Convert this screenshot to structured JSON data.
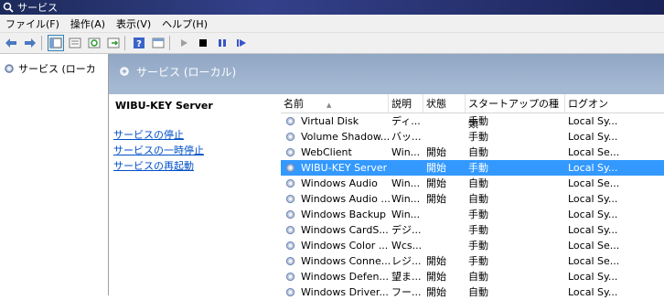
{
  "window": {
    "title": "サービス"
  },
  "menu": [
    "ファイル(F)",
    "操作(A)",
    "表示(V)",
    "ヘルプ(H)"
  ],
  "toolbar": {
    "icons": [
      "back-arrow-icon",
      "forward-arrow-icon",
      "console-tree-icon",
      "properties-icon",
      "refresh-icon",
      "export-list-icon",
      "help-icon",
      "standard-view-icon",
      "start-service-icon",
      "stop-service-icon",
      "pause-service-icon",
      "restart-service-icon"
    ],
    "colors": {
      "play": "#a0a0a0",
      "stop": "#000000",
      "pause": "#3a55c8",
      "restart": "#3a55c8"
    }
  },
  "tree": {
    "root_label": "サービス (ローカ"
  },
  "panel_header": {
    "title": "サービス (ローカル)"
  },
  "description": {
    "service_name": "WIBU-KEY Server",
    "links": [
      "サービスの停止",
      "サービスの一時停止",
      "サービスの再起動"
    ]
  },
  "columns": [
    "名前",
    "説明",
    "状態",
    "スタートアップの種類",
    "ログオン"
  ],
  "rows": [
    {
      "name": "Virtual Disk",
      "desc": "ディ...",
      "status": "",
      "startup": "手動",
      "logon": "Local Sy...",
      "selected": false
    },
    {
      "name": "Volume Shadow...",
      "desc": "バッ...",
      "status": "",
      "startup": "手動",
      "logon": "Local Sy...",
      "selected": false
    },
    {
      "name": "WebClient",
      "desc": "Win...",
      "status": "開始",
      "startup": "自動",
      "logon": "Local Se...",
      "selected": false
    },
    {
      "name": "WIBU-KEY Server",
      "desc": "",
      "status": "開始",
      "startup": "手動",
      "logon": "Local Sy...",
      "selected": true
    },
    {
      "name": "Windows Audio",
      "desc": "Win...",
      "status": "開始",
      "startup": "自動",
      "logon": "Local Se...",
      "selected": false
    },
    {
      "name": "Windows Audio ...",
      "desc": "Win...",
      "status": "開始",
      "startup": "自動",
      "logon": "Local Sy...",
      "selected": false
    },
    {
      "name": "Windows Backup",
      "desc": "Win...",
      "status": "",
      "startup": "手動",
      "logon": "Local Sy...",
      "selected": false
    },
    {
      "name": "Windows CardS...",
      "desc": "デジ...",
      "status": "",
      "startup": "手動",
      "logon": "Local Sy...",
      "selected": false
    },
    {
      "name": "Windows Color ...",
      "desc": "Wcs...",
      "status": "",
      "startup": "手動",
      "logon": "Local Se...",
      "selected": false
    },
    {
      "name": "Windows Conne...",
      "desc": "レジ...",
      "status": "開始",
      "startup": "手動",
      "logon": "Local Se...",
      "selected": false
    },
    {
      "name": "Windows Defen...",
      "desc": "望ま...",
      "status": "開始",
      "startup": "自動",
      "logon": "Local Sy...",
      "selected": false
    },
    {
      "name": "Windows Driver...",
      "desc": "フー...",
      "status": "開始",
      "startup": "自動",
      "logon": "Local Sy...",
      "selected": false
    }
  ]
}
